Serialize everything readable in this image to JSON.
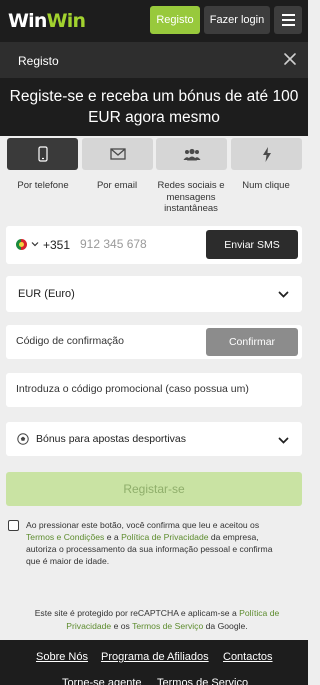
{
  "header": {
    "logo_part1": "Win",
    "logo_part2": "Win",
    "register_label": "Registo",
    "login_label": "Fazer login"
  },
  "modal": {
    "title": "Registo",
    "promo_text": "Registe-se e receba um bónus de até 100 EUR agora mesmo"
  },
  "tabs": [
    {
      "label": "Por telefone",
      "icon": "phone-icon",
      "active": true
    },
    {
      "label": "Por email",
      "icon": "envelope-icon",
      "active": false
    },
    {
      "label": "Redes sociais e mensagens instantâneas",
      "icon": "users-icon",
      "active": false
    },
    {
      "label": "Num clique",
      "icon": "lightning-icon",
      "active": false
    }
  ],
  "phone": {
    "country_code": "+351",
    "placeholder": "912 345 678",
    "send_sms_label": "Enviar SMS"
  },
  "currency": {
    "selected": "EUR (Euro)"
  },
  "confirmation": {
    "placeholder": "Código de confirmação",
    "confirm_label": "Confirmar"
  },
  "promo_code": {
    "placeholder": "Introduza o código promocional (caso possua um)"
  },
  "bonus": {
    "selected": "Bónus para apostas desportivas"
  },
  "register_button": "Registar-se",
  "consent": {
    "text1": "Ao pressionar este botão, você confirma que leu e aceitou os ",
    "terms_link": "Termos e Condições",
    "text2": " e a ",
    "privacy_link": "Política de Privacidade",
    "text3": " da empresa, autoriza o processamento da sua informação pessoal e confirma que é maior de idade."
  },
  "recaptcha": {
    "text1": "Este site é protegido por reCAPTCHA e aplicam-se a ",
    "privacy_link": "Política de Privacidade",
    "text2": " e os ",
    "terms_link": "Termos de Serviço",
    "text3": " da Google."
  },
  "footer": {
    "links": [
      "Sobre Nós",
      "Programa de Afiliados",
      "Contactos"
    ],
    "links_row2": [
      "Torne-se agente",
      "Termos de Serviço"
    ]
  },
  "colors": {
    "accent": "#98c93c",
    "dark": "#1d1d1d",
    "link": "#5d8c2e"
  }
}
